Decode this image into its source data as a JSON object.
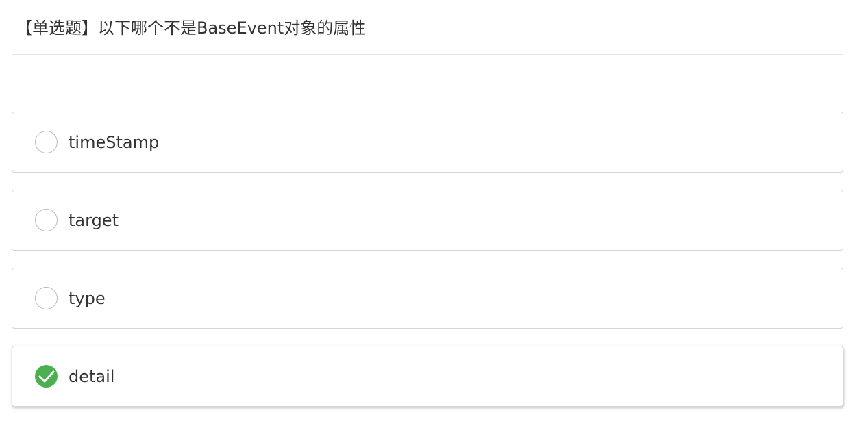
{
  "question": {
    "title": "【单选题】以下哪个不是BaseEvent对象的属性"
  },
  "options": [
    {
      "label": "timeStamp",
      "selected": false
    },
    {
      "label": "target",
      "selected": false
    },
    {
      "label": "type",
      "selected": false
    },
    {
      "label": "detail",
      "selected": true
    }
  ],
  "colors": {
    "selected_accent": "#4caf50",
    "border": "#d4d4d4",
    "text": "#333333"
  },
  "icons": {
    "unselected": "radio-circle-icon",
    "selected": "check-circle-icon"
  }
}
